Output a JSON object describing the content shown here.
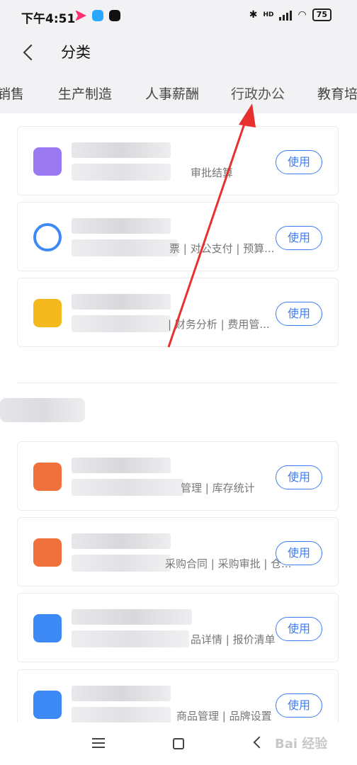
{
  "status_bar": {
    "time": "下午4:51",
    "network_label": "HD",
    "battery": "75"
  },
  "header": {
    "title": "分类"
  },
  "tabs": [
    "销售",
    "生产制造",
    "人事薪酬",
    "行政办公",
    "教育培"
  ],
  "cards": [
    {
      "icon": "purple-wallet-icon",
      "desc": "审批结算",
      "button": "使用",
      "icon_color": "#9b79f0"
    },
    {
      "icon": "blue-cloud-icon",
      "desc": "票 | 对公支付 | 预算...",
      "button": "使用",
      "icon_color": "#3d8af7"
    },
    {
      "icon": "yellow-invoice-icon",
      "desc": " | 财务分析 | 费用管...",
      "button": "使用",
      "icon_color": "#f5b920"
    },
    {
      "icon": "orange-lock-icon",
      "desc": "管理 | 库存统计",
      "button": "使用",
      "icon_color": "#f0713c"
    },
    {
      "icon": "orange-house-icon",
      "desc": "采购合同 | 采购审批 | 仓...",
      "button": "使用",
      "icon_color": "#f0713c"
    },
    {
      "icon": "blue-contact-icon",
      "desc": "品详情 | 报价清单",
      "button": "使用",
      "icon_color": "#3d8af7"
    },
    {
      "icon": "blue-clipboard-icon",
      "desc": "商品管理 | 品牌设置",
      "button": "使用",
      "icon_color": "#3d8af7"
    }
  ],
  "watermark": "Bai 经验",
  "colors": {
    "accent": "#3d7df5",
    "annotation_arrow": "#e8312f"
  }
}
